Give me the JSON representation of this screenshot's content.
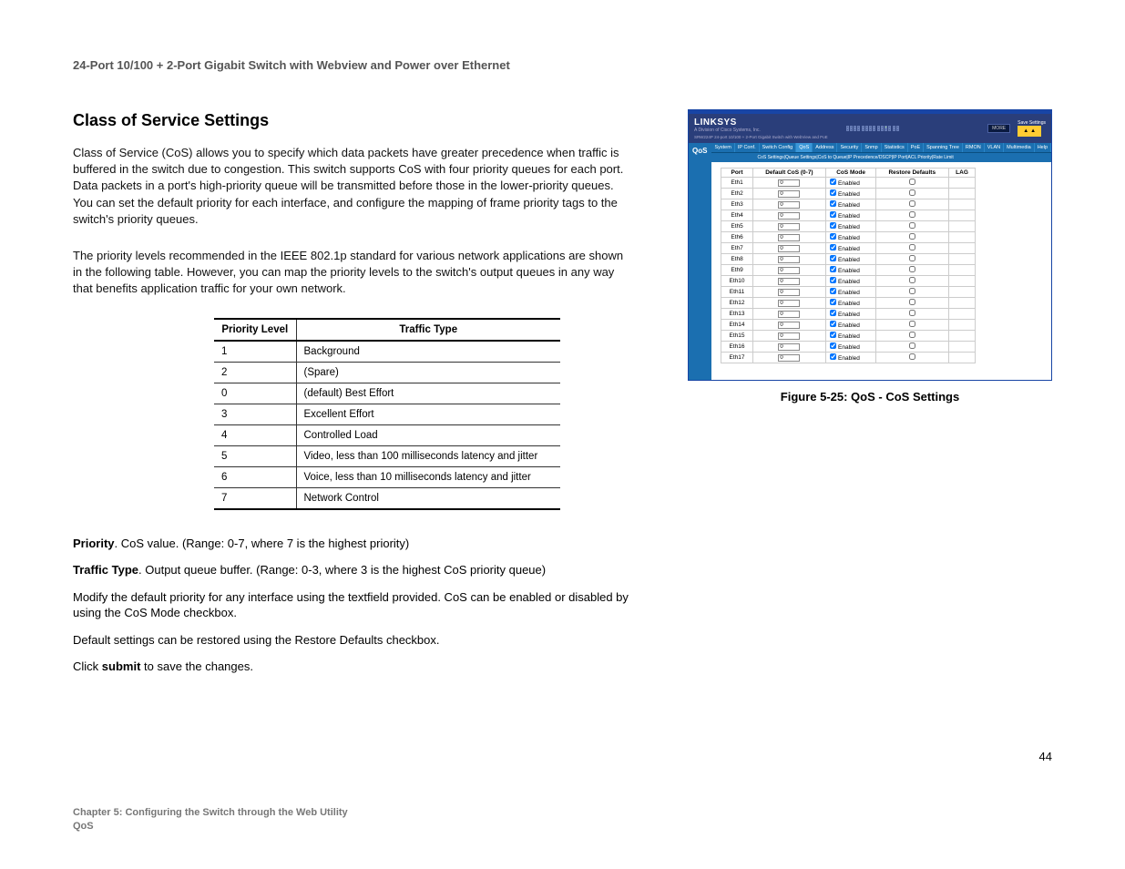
{
  "header_title": "24-Port 10/100 + 2-Port Gigabit Switch with Webview and Power over Ethernet",
  "section_title": "Class of Service Settings",
  "para1": "Class of Service (CoS) allows you to specify which data packets have greater precedence when traffic is buffered in the switch due to congestion. This switch supports CoS with four priority queues for each port. Data packets in a port's high-priority queue will be transmitted before those in the lower-priority queues. You can set the default priority for each interface, and configure the mapping of frame priority tags to the switch's priority queues.",
  "para2": "The priority levels recommended in the IEEE 802.1p standard for various network applications are shown in the following table. However, you can map the priority levels to the switch's output queues in any way that benefits application traffic for your own network.",
  "table_headers": {
    "col1": "Priority Level",
    "col2": "Traffic Type"
  },
  "table_rows": [
    {
      "level": "1",
      "type": "Background"
    },
    {
      "level": "2",
      "type": "(Spare)"
    },
    {
      "level": "0",
      "type": "(default) Best Effort"
    },
    {
      "level": "3",
      "type": "Excellent Effort"
    },
    {
      "level": "4",
      "type": "Controlled Load"
    },
    {
      "level": "5",
      "type": "Video, less than 100 milliseconds latency and jitter"
    },
    {
      "level": "6",
      "type": "Voice, less than 10 milliseconds latency and jitter"
    },
    {
      "level": "7",
      "type": "Network Control"
    }
  ],
  "def_priority_b": "Priority",
  "def_priority": ". CoS value. (Range: 0-7, where 7 is the highest priority)",
  "def_traffic_b": "Traffic Type",
  "def_traffic": ". Output queue buffer. (Range: 0-3, where 3 is the highest CoS priority queue)",
  "para_modify": "Modify the default priority for any interface using the textfield provided. CoS can be enabled or disabled by using the CoS Mode checkbox.",
  "para_restore": "Default settings can be restored using the Restore Defaults checkbox.",
  "para_submit_pre": "Click ",
  "para_submit_b": "submit",
  "para_submit_post": " to save the changes.",
  "footer_line1": "Chapter 5: Configuring the Switch through the Web Utility",
  "footer_line2": "QoS",
  "page_number": "44",
  "figure_caption": "Figure 5-25: QoS - CoS Settings",
  "figure": {
    "logo": "LINKSYS",
    "sublogo": "A Division of Cisco Systems, Inc.",
    "product_line": "SRW224P 24-port 10/100 + 2-Port Gigabit Switch with WebView and PoE",
    "more_btn": "MORE",
    "save_label": "Save Settings",
    "qos_label": "QoS",
    "tabs": [
      "System",
      "IP Conf.",
      "Switch Config",
      "QoS",
      "Address",
      "Security",
      "Snmp",
      "Statistics",
      "PoE",
      "Spanning Tree",
      "RMON",
      "VLAN",
      "Multimedia",
      "Help"
    ],
    "subtabs": "CoS Settings|Queue Settings|CoS to Queue|IP Precedence/DSCP|IP Port|ACL Priority|Rate Limit",
    "cos_headers": {
      "port": "Port",
      "def": "Default CoS (0-7)",
      "mode": "CoS Mode",
      "restore": "Restore Defaults",
      "lag": "LAG"
    },
    "cos_rows": [
      {
        "port": "Eth1",
        "v": "0"
      },
      {
        "port": "Eth2",
        "v": "0"
      },
      {
        "port": "Eth3",
        "v": "0"
      },
      {
        "port": "Eth4",
        "v": "0"
      },
      {
        "port": "Eth5",
        "v": "0"
      },
      {
        "port": "Eth6",
        "v": "0"
      },
      {
        "port": "Eth7",
        "v": "0"
      },
      {
        "port": "Eth8",
        "v": "0"
      },
      {
        "port": "Eth9",
        "v": "0"
      },
      {
        "port": "Eth10",
        "v": "0"
      },
      {
        "port": "Eth11",
        "v": "0"
      },
      {
        "port": "Eth12",
        "v": "0"
      },
      {
        "port": "Eth13",
        "v": "0"
      },
      {
        "port": "Eth14",
        "v": "0"
      },
      {
        "port": "Eth15",
        "v": "0"
      },
      {
        "port": "Eth16",
        "v": "0"
      },
      {
        "port": "Eth17",
        "v": "0"
      }
    ],
    "enabled_label": "Enabled"
  }
}
